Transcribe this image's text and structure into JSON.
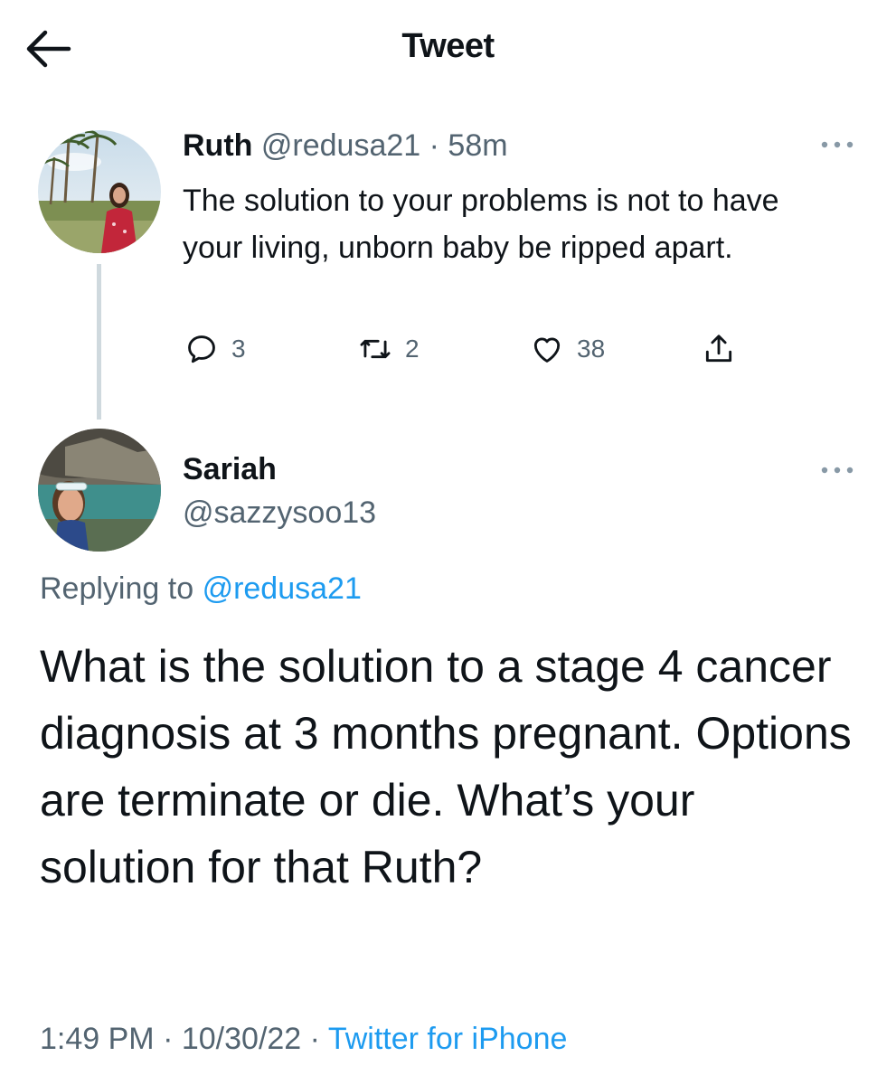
{
  "header": {
    "title": "Tweet",
    "back_icon": "arrow-left-icon"
  },
  "parent_tweet": {
    "name": "Ruth",
    "handle": "@redusa21",
    "separator": "·",
    "time": "58m",
    "text": "The solution to your problems is not to have your living, unborn baby be ripped apart.",
    "replies": "3",
    "retweets": "2",
    "likes": "38",
    "more_icon": "more-horizontal-icon"
  },
  "main_tweet": {
    "name": "Sariah",
    "handle": "@sazzysoo13",
    "replying_prefix": "Replying to",
    "replying_to": "@redusa21",
    "text": "What is the solution to a stage 4 cancer diagnosis at 3 months pregnant. Options are terminate or die. What’s your solution for that Ruth?",
    "time": "1:49 PM",
    "separator": "·",
    "date": "10/30/22",
    "source": "Twitter for iPhone",
    "more_icon": "more-horizontal-icon"
  },
  "colors": {
    "accent": "#1d9bf0",
    "muted": "#536471",
    "text": "#0f1419",
    "thread_line": "#cfd9de"
  }
}
